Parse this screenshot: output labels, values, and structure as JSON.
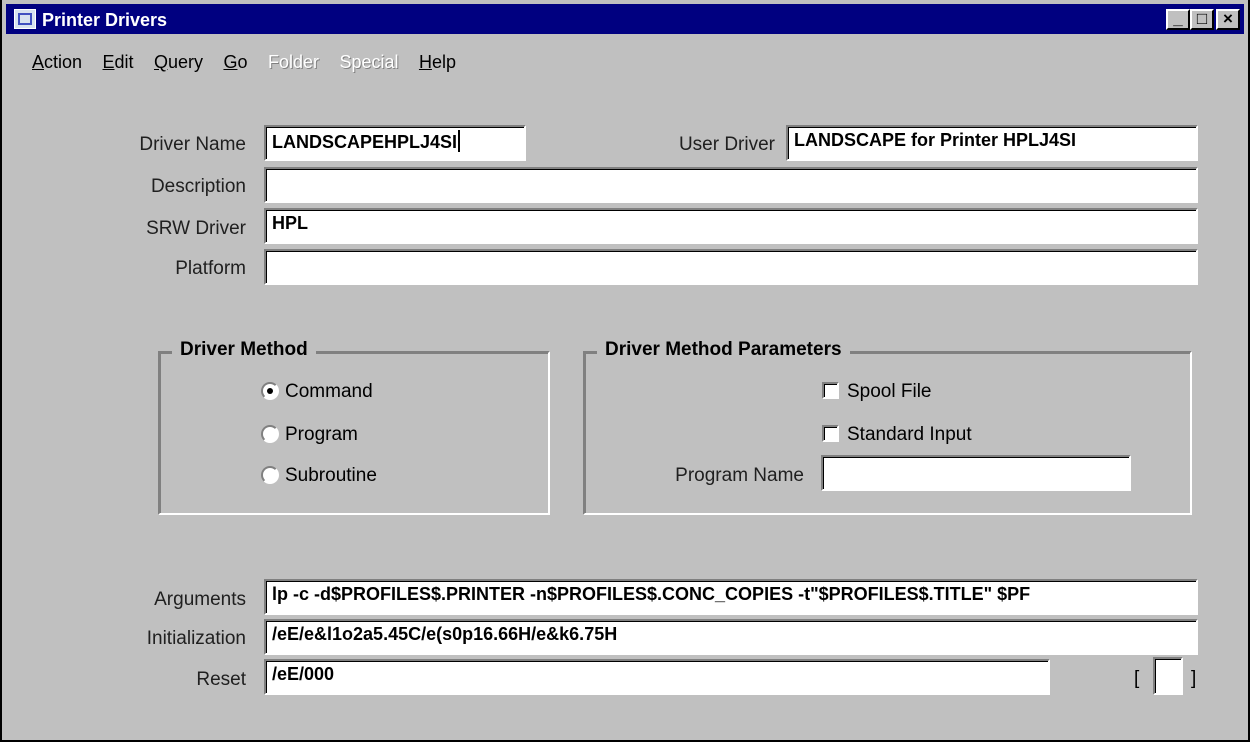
{
  "window": {
    "title": "Printer Drivers",
    "controls": {
      "minimize": "_",
      "maximize": "□",
      "close": "×"
    }
  },
  "menu": {
    "items": [
      {
        "label": "Action",
        "accel": "A",
        "rest": "ction",
        "enabled": true
      },
      {
        "label": "Edit",
        "accel": "E",
        "rest": "dit",
        "enabled": true
      },
      {
        "label": "Query",
        "accel": "Q",
        "rest": "uery",
        "enabled": true
      },
      {
        "label": "Go",
        "accel": "G",
        "rest": "o",
        "enabled": true
      },
      {
        "label": "Folder",
        "accel": "",
        "rest": "Folder",
        "enabled": false
      },
      {
        "label": "Special",
        "accel": "",
        "rest": "Special",
        "enabled": false
      },
      {
        "label": "Help",
        "accel": "H",
        "rest": "elp",
        "enabled": true
      }
    ]
  },
  "form": {
    "driver_name_label": "Driver Name",
    "driver_name": "LANDSCAPEHPLJ4SI",
    "user_driver_label": "User Driver",
    "user_driver": "LANDSCAPE for Printer HPLJ4SI",
    "description_label": "Description",
    "description": "",
    "srw_driver_label": "SRW Driver",
    "srw_driver": "HPL",
    "platform_label": "Platform",
    "platform": "",
    "arguments_label": "Arguments",
    "arguments": "lp -c -d$PROFILES$.PRINTER -n$PROFILES$.CONC_COPIES -t\"$PROFILES$.TITLE\" $PF",
    "initialization_label": "Initialization",
    "initialization": "/eE/e&l1o2a5.45C/e(s0p16.66H/e&k6.75H",
    "reset_label": "Reset",
    "reset": "/eE/000"
  },
  "driver_method": {
    "title": "Driver Method",
    "options": [
      {
        "label": "Command",
        "selected": true
      },
      {
        "label": "Program",
        "selected": false
      },
      {
        "label": "Subroutine",
        "selected": false
      }
    ]
  },
  "driver_params": {
    "title": "Driver Method Parameters",
    "spool_file_label": "Spool File",
    "spool_file": false,
    "standard_input_label": "Standard Input",
    "standard_input": false,
    "program_name_label": "Program Name",
    "program_name": ""
  },
  "record_indicator": {
    "left": "[",
    "right": "]"
  }
}
